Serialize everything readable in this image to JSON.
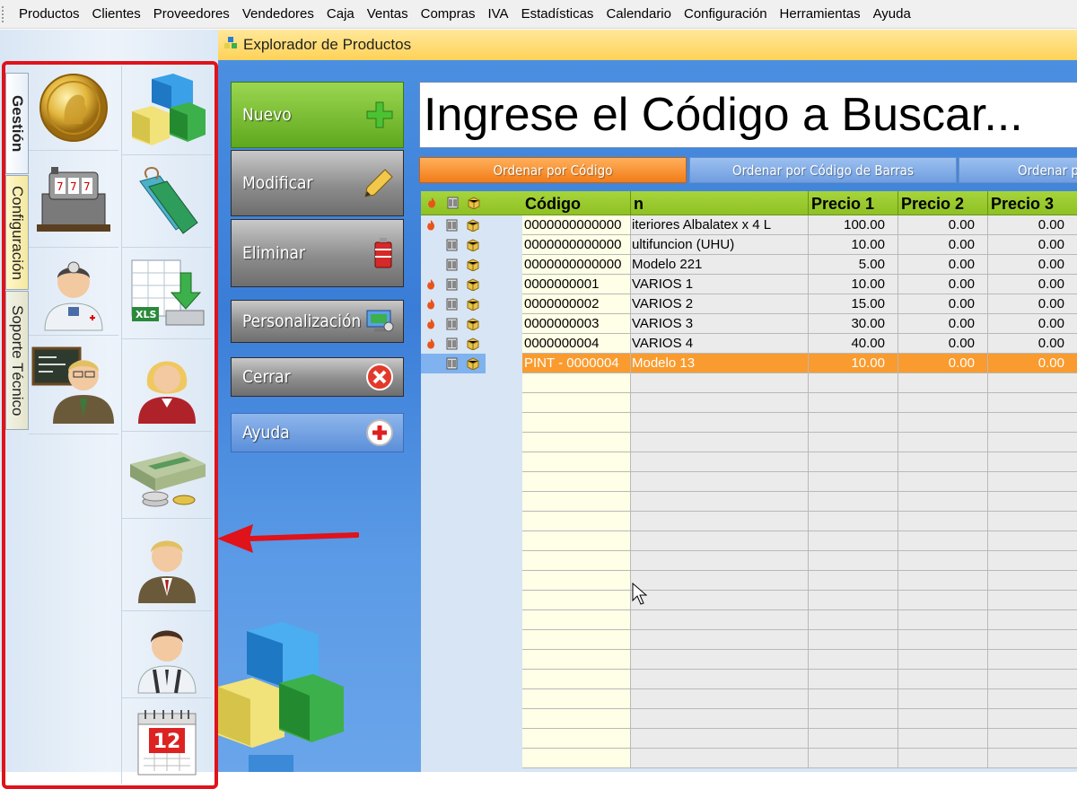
{
  "menu": [
    "Productos",
    "Clientes",
    "Proveedores",
    "Vendedores",
    "Caja",
    "Ventas",
    "Compras",
    "IVA",
    "Estadísticas",
    "Calendario",
    "Configuración",
    "Herramientas",
    "Ayuda"
  ],
  "sidebar": {
    "tabs": [
      "Gestión",
      "Configuración",
      "Soporte Técnico"
    ],
    "icons_col1": [
      "coin-icon",
      "cash-register-icon",
      "doctor-icon",
      "teacher-icon"
    ],
    "icons_col2": [
      "cubes-icon",
      "tags-icon",
      "xls-import-icon",
      "woman-user-icon",
      "money-stack-icon",
      "businessman-icon",
      "man-suspenders-icon",
      "calendar-icon"
    ]
  },
  "window": {
    "title": "Explorador de Productos"
  },
  "actions": {
    "nuevo": "Nuevo",
    "modificar": "Modificar",
    "eliminar": "Eliminar",
    "personalizacion": "Personalización",
    "cerrar": "Cerrar",
    "ayuda": "Ayuda"
  },
  "search": {
    "placeholder": "Ingrese el Código a Buscar..."
  },
  "sort_buttons": [
    "Ordenar por Código",
    "Ordenar por Código de Barras",
    "Ordenar p"
  ],
  "calendar_day": "12",
  "grid": {
    "columns": [
      "Código",
      "n",
      "Precio 1",
      "Precio 2",
      "Precio 3"
    ],
    "rows": [
      {
        "fire": true,
        "code": "0000000000000",
        "desc": "iteriores Albalatex x 4 L",
        "p1": "100.00",
        "p2": "0.00",
        "p3": "0.00"
      },
      {
        "fire": false,
        "code": "0000000000000",
        "desc": "ultifuncion (UHU)",
        "p1": "10.00",
        "p2": "0.00",
        "p3": "0.00"
      },
      {
        "fire": false,
        "code": "0000000000000",
        "desc": "Modelo 221",
        "p1": "5.00",
        "p2": "0.00",
        "p3": "0.00"
      },
      {
        "fire": true,
        "code": "0000000001",
        "desc": "VARIOS 1",
        "p1": "10.00",
        "p2": "0.00",
        "p3": "0.00"
      },
      {
        "fire": true,
        "code": "0000000002",
        "desc": "VARIOS 2",
        "p1": "15.00",
        "p2": "0.00",
        "p3": "0.00"
      },
      {
        "fire": true,
        "code": "0000000003",
        "desc": "VARIOS 3",
        "p1": "30.00",
        "p2": "0.00",
        "p3": "0.00"
      },
      {
        "fire": true,
        "code": "0000000004",
        "desc": "VARIOS 4",
        "p1": "40.00",
        "p2": "0.00",
        "p3": "0.00"
      },
      {
        "fire": false,
        "code": "PINT - 0000004",
        "desc": "Modelo 13",
        "p1": "10.00",
        "p2": "0.00",
        "p3": "0.00",
        "selected": true
      }
    ]
  },
  "colors": {
    "menu_bg": "#f0f0f0",
    "title_bar": "#ffd257",
    "main_bg": "#3a7dd8",
    "grid_header": "#8ec123",
    "selection": "#f99b2e",
    "annotation_red": "#e0121a"
  }
}
